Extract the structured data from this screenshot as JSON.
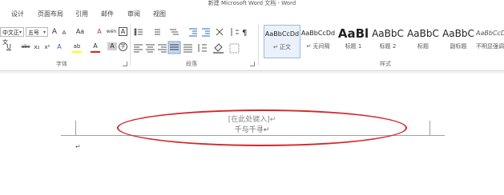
{
  "window": {
    "title": "新建 Microsoft Word 文档 - Word"
  },
  "tabs": [
    {
      "label": "设计"
    },
    {
      "label": "页面布局"
    },
    {
      "label": "引用"
    },
    {
      "label": "邮件"
    },
    {
      "label": "审阅"
    },
    {
      "label": "视图"
    }
  ],
  "font_group": {
    "label": "字体",
    "font_name": "中文正文",
    "font_size": "五号",
    "grow_font": "A",
    "shrink_font": "A",
    "change_case": "Aa",
    "clear_format": "A",
    "phonetic": "wén",
    "border_char": "A",
    "underline": "U",
    "strike": "abc",
    "subscript": "x₂",
    "superscript": "x²",
    "text_effect": "A",
    "highlight": "ab",
    "font_color": "A",
    "char_shade": "A",
    "enclose": "字"
  },
  "paragraph_group": {
    "label": "段落"
  },
  "styles_group": {
    "label": "样式",
    "items": [
      {
        "sample": "AaBbCcDd",
        "name": "↵ 正文"
      },
      {
        "sample": "AaBbCcDd",
        "name": "↵ 无间隔"
      },
      {
        "sample": "AaBl",
        "name": "标题 1"
      },
      {
        "sample": "AaBbC",
        "name": "标题 2"
      },
      {
        "sample": "AaBbC",
        "name": "标题"
      },
      {
        "sample": "AaBbC",
        "name": "副标题"
      },
      {
        "sample": "AaBbCcDd",
        "name": "不明显强调"
      }
    ]
  },
  "document": {
    "header_placeholder": "[在此处键入]↵",
    "header_text": "千与千寻↵",
    "para_mark": "↵"
  },
  "colors": {
    "highlight_ellipse": "#d3262b",
    "font_color_bar": "#e0201b",
    "highlight_bar": "#ffff00"
  }
}
